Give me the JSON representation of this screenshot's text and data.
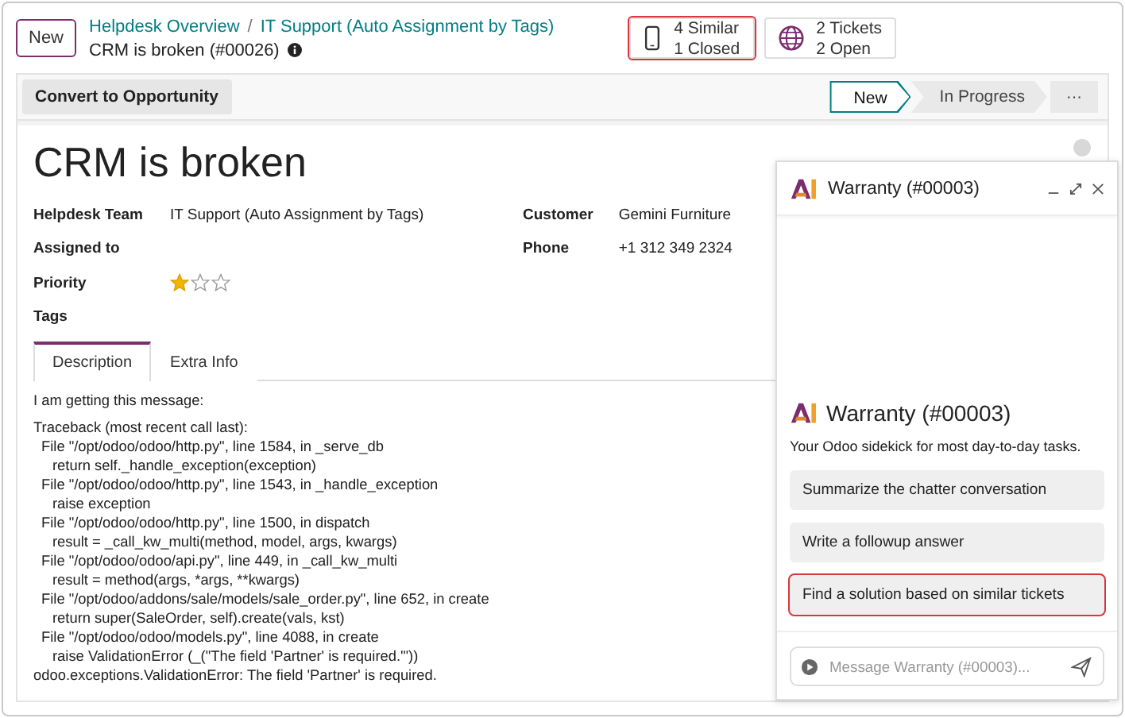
{
  "topbar": {
    "new_button": "New",
    "breadcrumbs": [
      "Helpdesk Overview",
      "IT Support (Auto Assignment by Tags)"
    ],
    "breadcrumb_separator": "/",
    "record_title": "CRM is broken (#00026)",
    "smart_buttons": [
      {
        "kind": "phone",
        "lines": [
          "4 Similar",
          "1 Closed"
        ],
        "highlighted": true
      },
      {
        "kind": "globe",
        "lines": [
          "2 Tickets",
          "2 Open"
        ],
        "highlighted": false
      }
    ]
  },
  "statusbar": {
    "action_button": "Convert to Opportunity",
    "stages": [
      {
        "label": "New",
        "selected": true
      },
      {
        "label": "In Progress",
        "selected": false
      }
    ],
    "more_button": "···"
  },
  "form": {
    "title": "CRM is broken",
    "left_fields": [
      {
        "label": "Helpdesk Team",
        "value": "IT Support (Auto Assignment by Tags)",
        "kind": "text"
      },
      {
        "label": "Assigned to",
        "kind": "text"
      },
      {
        "label": "Priority",
        "kind": "stars",
        "stars": 1
      },
      {
        "label": "Tags",
        "kind": "text"
      }
    ],
    "right_fields": [
      {
        "label": "Customer",
        "value": "Gemini Furniture"
      },
      {
        "label": "Phone",
        "value": "+1 312 349 2324"
      }
    ],
    "tabs": [
      {
        "label": "Description",
        "selected": true
      },
      {
        "label": "Extra Info",
        "selected": false
      }
    ],
    "description": [
      {
        "kind": "text",
        "text": "I am getting this message:"
      },
      {
        "kind": "head",
        "text": "Traceback (most recent call last):"
      },
      {
        "kind": "file",
        "text": "File \"/opt/odoo/odoo/http.py\", line 1584, in _serve_db"
      },
      {
        "kind": "code",
        "text": "return self._handle_exception(exception)"
      },
      {
        "kind": "file",
        "text": "File \"/opt/odoo/odoo/http.py\", line 1543, in _handle_exception"
      },
      {
        "kind": "code",
        "text": "raise exception"
      },
      {
        "kind": "file",
        "text": "File \"/opt/odoo/odoo/http.py\", line 1500, in dispatch"
      },
      {
        "kind": "code",
        "text": "result = _call_kw_multi(method, model, args, kwargs)"
      },
      {
        "kind": "file",
        "text": "File \"/opt/odoo/odoo/api.py\", line 449, in _call_kw_multi"
      },
      {
        "kind": "code",
        "text": "result = method(args, *args, **kwargs)"
      },
      {
        "kind": "file",
        "text": "File \"/opt/odoo/addons/sale/models/sale_order.py\", line 652, in create"
      },
      {
        "kind": "code",
        "text": "return super(SaleOrder, self).create(vals, kst)"
      },
      {
        "kind": "file",
        "text": "File \"/opt/odoo/odoo/models.py\", line 4088, in create"
      },
      {
        "kind": "code",
        "text": "raise ValidationError (_(\"The field 'Partner' is required.'\"))"
      },
      {
        "kind": "head",
        "text": "odoo.exceptions.ValidationError: The field 'Partner' is required."
      }
    ]
  },
  "chat": {
    "title": "Warranty (#00003)",
    "intro_title": "Warranty (#00003)",
    "intro_text": "Your Odoo sidekick for most day-to-day tasks.",
    "suggestions": [
      {
        "label": "Summarize the chatter conversation",
        "highlighted": false
      },
      {
        "label": "Write a followup answer",
        "highlighted": false
      },
      {
        "label": "Find a solution based on similar tickets",
        "highlighted": true
      }
    ],
    "input": {
      "placeholder": "Message Warranty (#00003)..."
    }
  }
}
